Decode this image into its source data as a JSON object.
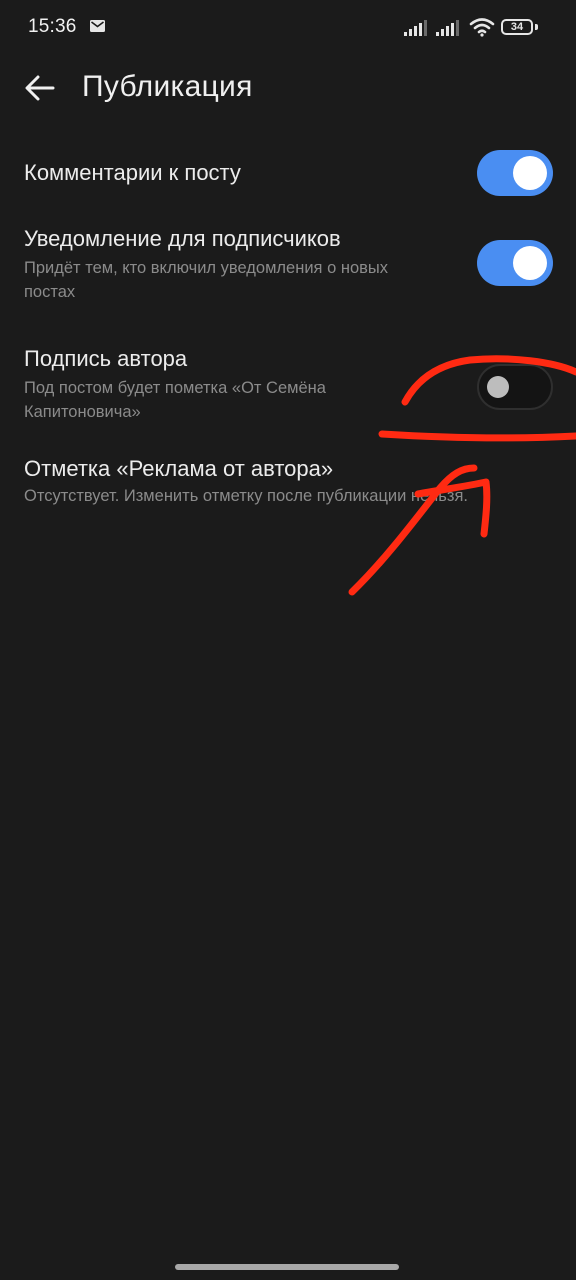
{
  "status_bar": {
    "time": "15:36",
    "battery_level": "34",
    "icons": [
      "mail-icon",
      "cell-signal-icon",
      "cell-signal-icon",
      "wifi-icon",
      "battery-icon"
    ]
  },
  "toolbar": {
    "back_icon": "arrow-left-icon",
    "title": "Публикация"
  },
  "settings": [
    {
      "title": "Комментарии к посту",
      "subtitle": "",
      "enabled": true
    },
    {
      "title": "Уведомление для подписчиков",
      "subtitle_line1": "Придёт тем, кто включил уведомления о новых",
      "subtitle_line2": "постах",
      "enabled": true
    },
    {
      "title": "Подпись автора",
      "subtitle_line1": "Под постом будет пометка «От Семёна",
      "subtitle_line2": "Капитоновича»",
      "enabled": false
    },
    {
      "title": "Отметка «Реклама от автора»",
      "subtitle_line1": "Отсутствует. Изменить отметку после публикации нельзя."
    }
  ],
  "colors": {
    "background": "#1b1b1b",
    "toggle_on": "#4a8ef2",
    "annotation": "#ff2a12"
  }
}
